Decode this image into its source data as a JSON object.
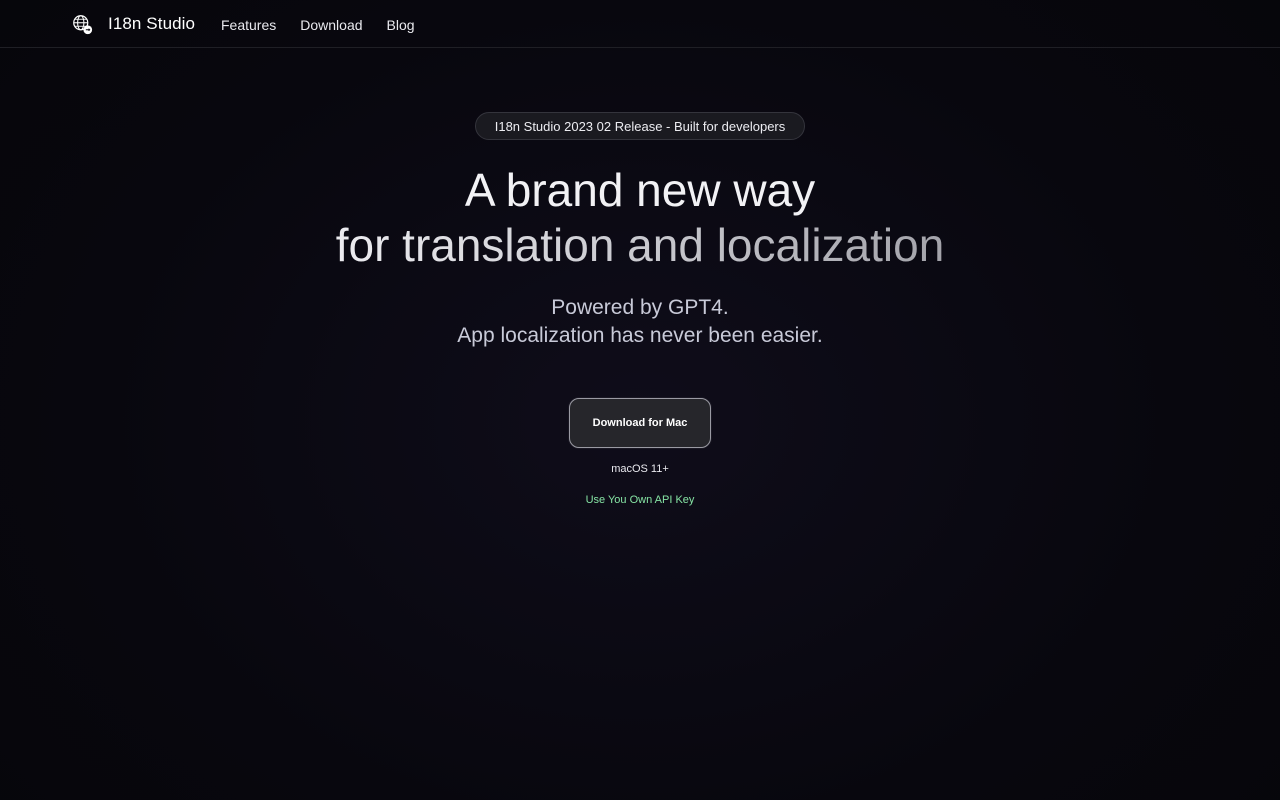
{
  "nav": {
    "brand": "I18n Studio",
    "brand_icon": "globe-icon",
    "links": [
      {
        "label": "Features"
      },
      {
        "label": "Download"
      },
      {
        "label": "Blog"
      }
    ]
  },
  "hero": {
    "badge": "I18n Studio 2023 02 Release - Built for developers",
    "headline_line1": "A brand new way",
    "headline_line2": "for translation and localization",
    "sub_line1": "Powered by GPT4.",
    "sub_line2": "App localization has never been easier.",
    "cta_label": "Download for Mac",
    "requirement": "macOS 11+",
    "api_key_link": "Use You Own API Key"
  },
  "colors": {
    "background": "#08070e",
    "accent_link": "#86e4a4",
    "button_bg": "#26262b"
  }
}
